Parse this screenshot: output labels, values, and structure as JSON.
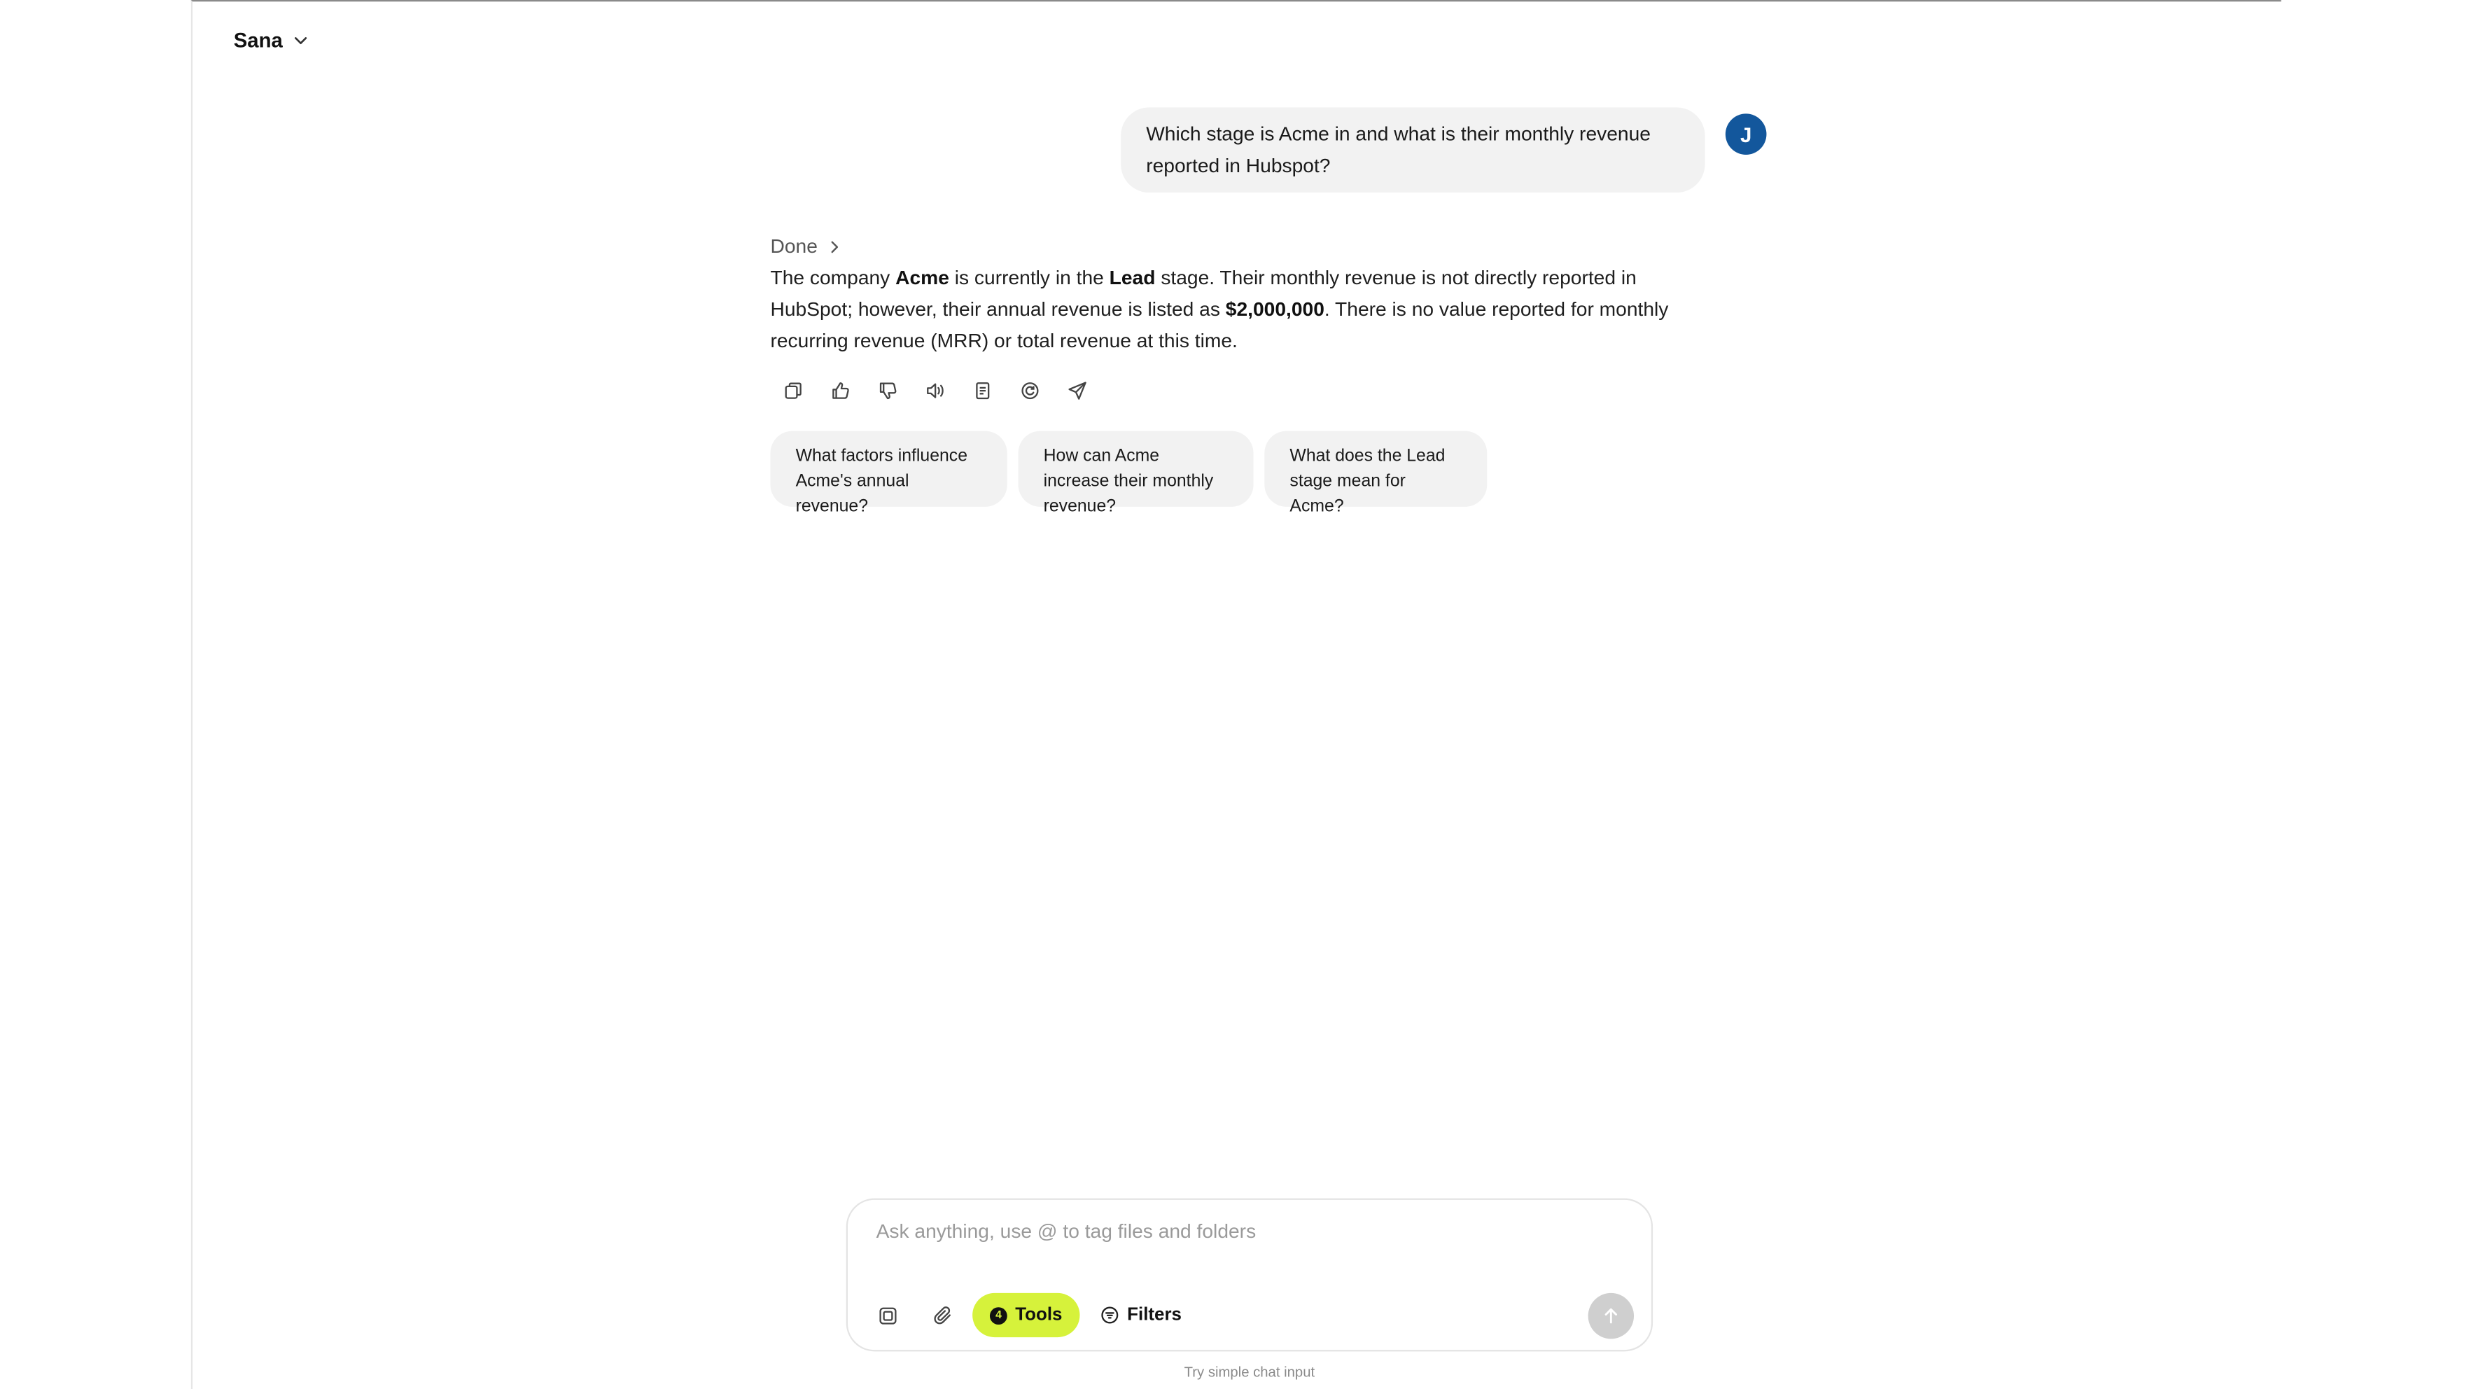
{
  "app": {
    "workspace_label": "Sana"
  },
  "conversation": {
    "user_message": "Which stage is Acme in and what is their monthly revenue reported in Hubspot?",
    "user_initial": "J",
    "status_label": "Done",
    "answer": {
      "t1": "The company ",
      "b1": "Acme",
      "t2": " is currently in the ",
      "b2": "Lead",
      "t3": " stage. Their monthly revenue is not directly reported in HubSpot; however, their annual revenue is listed as ",
      "b3": "$2,000,000",
      "t4": ". There is no value reported for monthly recurring revenue (MRR) or total revenue at this time."
    },
    "action_icons": [
      "copy-icon",
      "thumbs-up-icon",
      "thumbs-down-icon",
      "speaker-icon",
      "document-icon",
      "refresh-icon",
      "send-icon"
    ],
    "suggestions": [
      "What factors influence Acme's annual revenue?",
      "How can Acme increase their monthly revenue?",
      "What does the Lead stage mean for Acme?"
    ]
  },
  "composer": {
    "placeholder": "Ask anything, use @ to tag files and folders",
    "value": "",
    "tools_count": "4",
    "tools_label": "Tools",
    "filters_label": "Filters",
    "simple_input_link": "Try simple chat input"
  },
  "colors": {
    "avatar": "#13579c",
    "tools_accent": "#d6f23b",
    "bubble_bg": "#f2f2f2",
    "send_disabled": "#cfcfcf"
  }
}
